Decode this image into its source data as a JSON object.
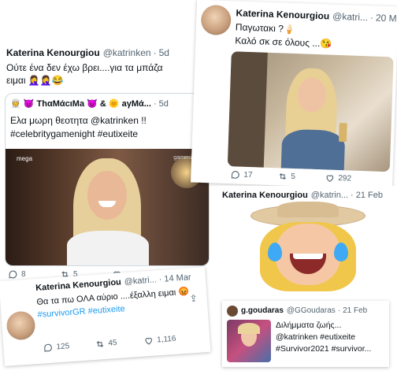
{
  "tweet1": {
    "name": "Katerina Kenourgiou",
    "handle": "@katrinken",
    "age": "5d",
    "text": "Ούτε ένα δεν έχω βρει....για τα μπάζα",
    "text2": "ειμαι",
    "emoji": "🤦‍♀️🤦‍♀️😂",
    "quote": {
      "name_prefix": "👳 😈 ΤhαΜάcιΜa 😈 & 🌞",
      "name_rest": "aγMά...",
      "age": "5d",
      "text1": "Ελα μωρη θεοτητα @katrinken !!",
      "text2": "#celebritygamenight #eutixeite",
      "tv_logo": "mega",
      "tv_watermark": "gamenight"
    },
    "stats": {
      "replies": "8",
      "retweets": "5",
      "likes": ""
    }
  },
  "tweet2": {
    "name": "Katerina Kenourgiou",
    "handle": "@katri...",
    "date": "20 M",
    "text1": "Παγωτακι ?🍦",
    "text2": "Καλό σκ σε όλους ...😘",
    "stats": {
      "replies": "17",
      "retweets": "5",
      "likes": "292"
    }
  },
  "tweet3": {
    "name": "Katerina Kenourgiou",
    "handle": "@katrin...",
    "date": "21 Feb"
  },
  "tweet4": {
    "name": "Katerina Kenourgiou",
    "handle": "@katri...",
    "date": "14 Mar",
    "text1": "Θα τα πω ΟΛΑ αύριο ....έξαλλη ειμαι 😡",
    "hashtags": "#survivorGR #eutixeite",
    "stats": {
      "replies": "125",
      "retweets": "45",
      "likes": "1,116"
    }
  },
  "tweet5": {
    "name": "g.goudaras",
    "handle": "@GGoudaras",
    "date": "21 Feb",
    "text1": "Διλήμματα ζωής...",
    "text2": "@katrinken #eutixeite",
    "text3": "#Survivor2021 #survivor..."
  },
  "icons": {
    "more": "more-icon",
    "reply": "reply-icon",
    "retweet": "retweet-icon",
    "like": "like-icon",
    "share": "share-icon"
  },
  "colors": {
    "link": "#1d9bf0",
    "muted": "#536471"
  }
}
